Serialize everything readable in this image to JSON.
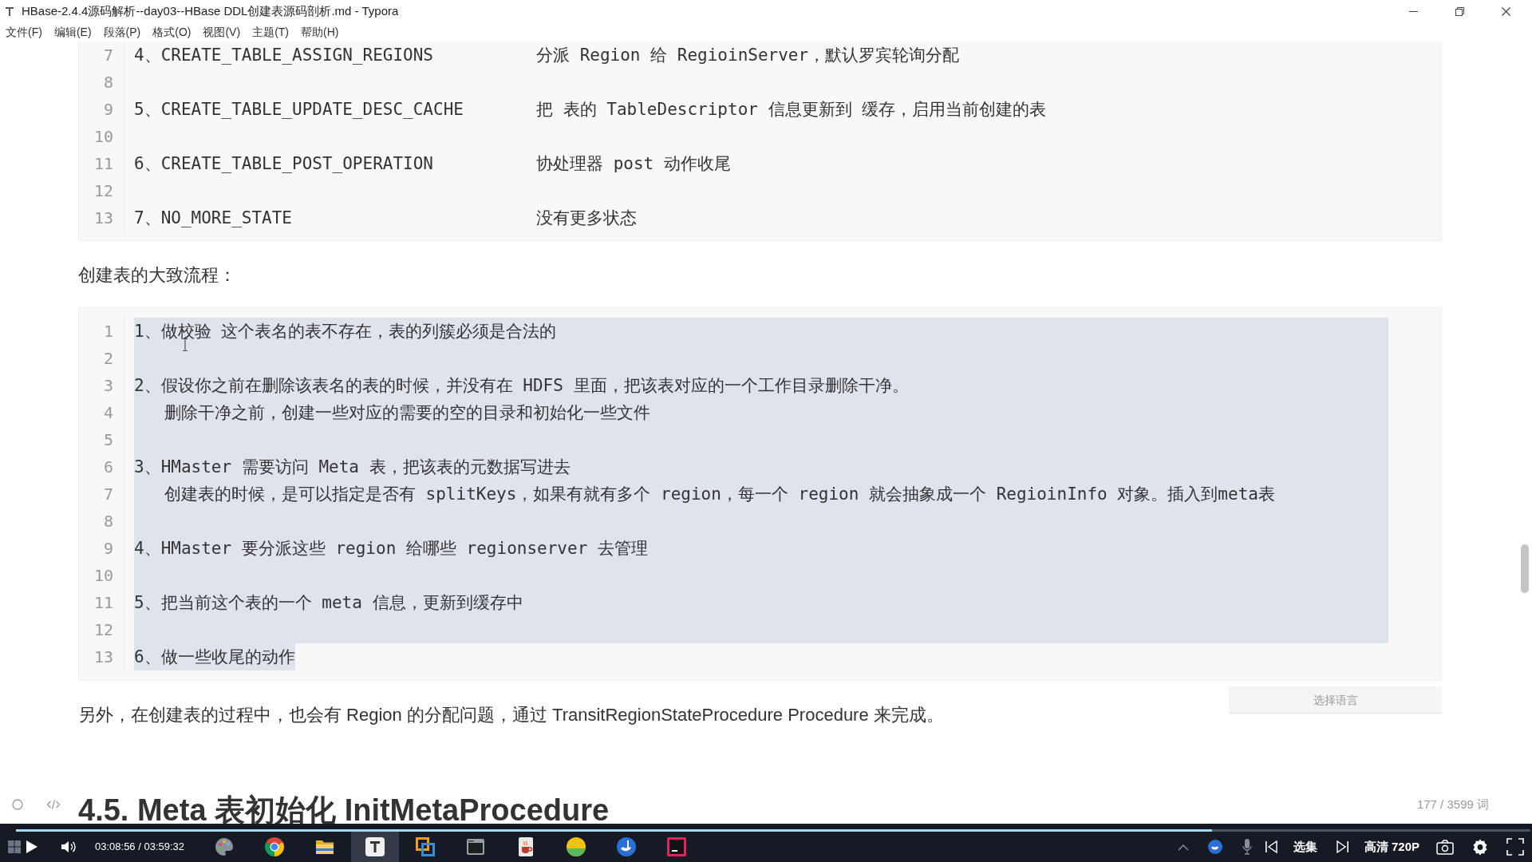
{
  "window": {
    "title": "HBase-2.4.4源码解析--day03--HBase DDL创建表源码剖析.md - Typora"
  },
  "menu": [
    "文件(F)",
    "编辑(E)",
    "段落(P)",
    "格式(O)",
    "视图(V)",
    "主题(T)",
    "帮助(H)"
  ],
  "editor": {
    "blocks": [
      {
        "kind": "code",
        "lines": [
          {
            "number": "7",
            "cells": [
              "4、CREATE_TABLE_ASSIGN_REGIONS",
              "分派 Region 给 RegioinServer，默认罗宾轮询分配"
            ]
          },
          {
            "number": "8"
          },
          {
            "number": "9",
            "cells": [
              "5、CREATE_TABLE_UPDATE_DESC_CACHE",
              "把 表的 TableDescriptor 信息更新到 缓存，启用当前创建的表"
            ]
          },
          {
            "number": "10"
          },
          {
            "number": "11",
            "cells": [
              "6、CREATE_TABLE_POST_OPERATION",
              "协处理器 post 动作收尾"
            ]
          },
          {
            "number": "12"
          },
          {
            "number": "13",
            "cells": [
              "7、NO_MORE_STATE",
              "没有更多状态"
            ]
          }
        ]
      },
      {
        "kind": "paragraph",
        "text": "创建表的大致流程："
      },
      {
        "kind": "code",
        "language_field": {
          "placeholder": "选择语言"
        },
        "lines": [
          {
            "number": "1",
            "selected": true,
            "cells": [
              "1、做校验 这个表名的表不存在，表的列簇必须是合法的"
            ]
          },
          {
            "number": "2",
            "selected": true
          },
          {
            "number": "3",
            "selected": true,
            "cells": [
              "2、假设你之前在删除该表名的表的时候，并没有在 HDFS 里面，把该表对应的一个工作目录删除干净。"
            ]
          },
          {
            "number": "4",
            "selected": true,
            "cells": [
              "   删除干净之前，创建一些对应的需要的空的目录和初始化一些文件"
            ]
          },
          {
            "number": "5",
            "selected": true
          },
          {
            "number": "6",
            "selected": true,
            "cells": [
              "3、HMaster 需要访问 Meta 表，把该表的元数据写进去"
            ]
          },
          {
            "number": "7",
            "selected": true,
            "cells": [
              "   创建表的时候，是可以指定是否有 splitKeys，如果有就有多个 region，每一个 region 就会抽象成一个 RegioinInfo 对象。插入到meta表"
            ]
          },
          {
            "number": "8",
            "selected": true
          },
          {
            "number": "9",
            "selected": true,
            "cells": [
              "4、HMaster 要分派这些 region 给哪些 regionserver 去管理"
            ]
          },
          {
            "number": "10",
            "selected": true
          },
          {
            "number": "11",
            "selected": true,
            "cells": [
              "5、把当前这个表的一个 meta 信息，更新到缓存中"
            ]
          },
          {
            "number": "12",
            "selected": true
          },
          {
            "number": "13",
            "selected": true,
            "cells": [
              "6、做一些收尾的动作"
            ]
          }
        ]
      },
      {
        "kind": "paragraph",
        "text": "另外，在创建表的过程中，也会有 Region 的分配问题，通过 TransitRegionStateProcedure Procedure 来完成。"
      },
      {
        "kind": "heading",
        "text": "4.5. Meta 表初始化 InitMetaProcedure"
      }
    ]
  },
  "status_bar": {
    "word_count": "177 / 3599 词"
  },
  "player": {
    "playing": false,
    "time": "03:08:56 / 03:59:32",
    "level": 0.79,
    "episodes": "选集",
    "quality": "高清 720P"
  },
  "taskbar": {
    "apps": [
      {
        "kind": "palette",
        "selected": false
      },
      {
        "kind": "round-logo",
        "selected": false
      },
      {
        "kind": "folder",
        "selected": false
      },
      {
        "kind": "t-tile",
        "selected": true
      },
      {
        "kind": "squares",
        "selected": false
      },
      {
        "kind": "terminal",
        "selected": false
      },
      {
        "kind": "cup",
        "selected": false
      },
      {
        "kind": "ball",
        "selected": false
      },
      {
        "kind": "round-app",
        "selected": false
      },
      {
        "kind": "dark-tile",
        "selected": false
      }
    ]
  }
}
